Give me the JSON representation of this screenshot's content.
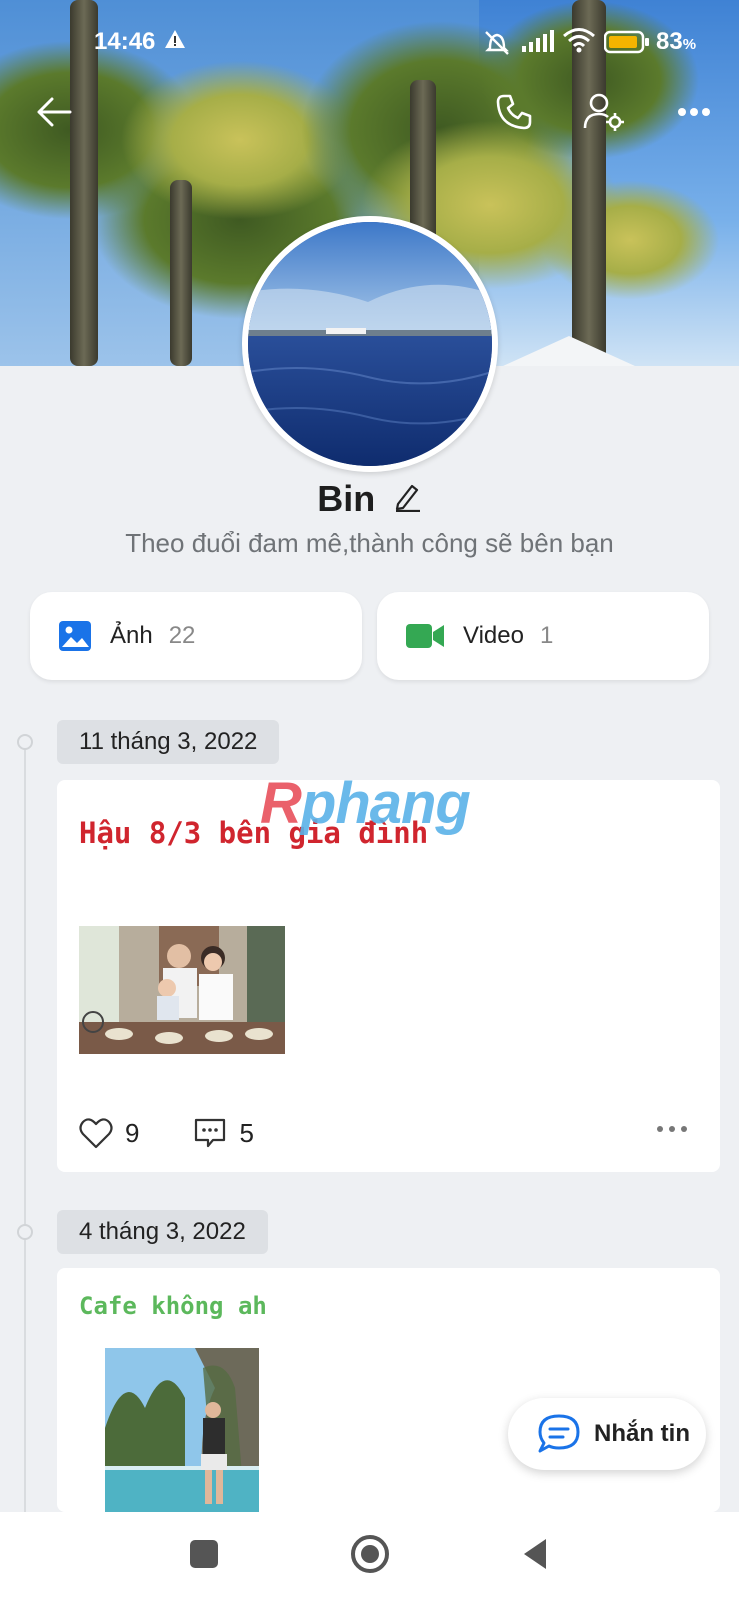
{
  "status_bar": {
    "time": "14:46",
    "battery_pct": "83",
    "battery_unit": "%"
  },
  "profile": {
    "name": "Bin",
    "bio": "Theo đuổi đam mê,thành công sẽ bên bạn"
  },
  "media": {
    "photos": {
      "label": "Ảnh",
      "count": "22"
    },
    "videos": {
      "label": "Video",
      "count": "1"
    }
  },
  "watermark": {
    "first": "R",
    "rest": "phang"
  },
  "posts": [
    {
      "date": "11 tháng 3, 2022",
      "text": "Hậu 8/3 bên gia đình",
      "text_color": "#d0252e",
      "likes": "9",
      "comments": "5"
    },
    {
      "date": "4 tháng 3, 2022",
      "text": "Cafe không ah",
      "text_color": "#5cb85c"
    }
  ],
  "fab": {
    "label": "Nhắn tin"
  },
  "colors": {
    "accent": "#1a73e8",
    "video_green": "#34a853"
  }
}
